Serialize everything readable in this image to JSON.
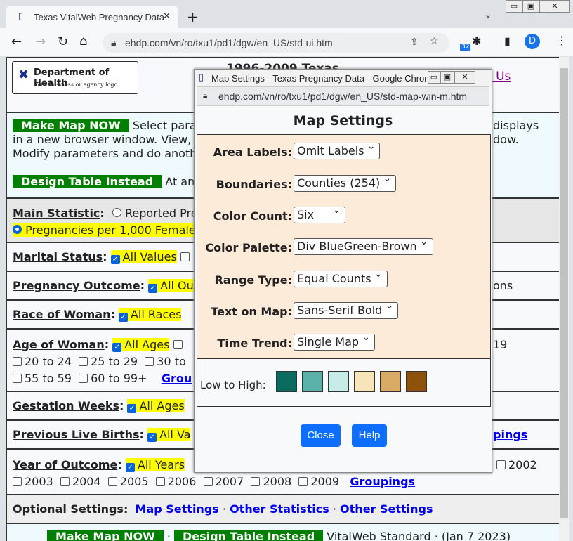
{
  "browser": {
    "tab_title": "Texas VitalWeb Pregnancy Data -",
    "url": "ehdp.com/vn/ro/txu1/pd1/dgw/en_US/std-ui.htm",
    "ext_badge": "32",
    "profile": "D"
  },
  "header": {
    "logo_title": "Department of Health",
    "logo_sub": "Your business or agency logo",
    "title_partial": "1996-2009 Texas",
    "contact_partial": "t Us"
  },
  "intro": {
    "make_map": "Make Map NOW",
    "line1": "Select para",
    "line1_right": "displays",
    "line2": "in a new browser window. View,",
    "line2_right": "dow.",
    "line3": "Modify parameters and do anoth",
    "design_table": "Design Table Instead",
    "design_text": "At an"
  },
  "main_stat": {
    "label": "Main Statistic",
    "opt1": "Reported Pre",
    "opt2": "Pregnancies per 1,000 Female"
  },
  "rows": {
    "marital": {
      "label": "Marital Status",
      "all": "All Values"
    },
    "outcome": {
      "label": "Pregnancy Outcome",
      "all": "All Ou",
      "right": "ons"
    },
    "race": {
      "label": "Race of Woman",
      "all": "All Races"
    },
    "age": {
      "label": "Age of Woman",
      "all": "All Ages",
      "right": "19",
      "opts": [
        "20 to 24",
        "25 to 29",
        "30 to",
        "55 to 59",
        "60 to 99+"
      ],
      "groupings": "Grou"
    },
    "gestation": {
      "label": "Gestation Weeks",
      "all": "All Ages"
    },
    "previous": {
      "label": "Previous Live Births",
      "all": "All Va",
      "groupings": "pings"
    },
    "year": {
      "label": "Year of Outcome",
      "all": "All Years",
      "right": "2002",
      "opts": [
        "2003",
        "2004",
        "2005",
        "2006",
        "2007",
        "2008",
        "2009"
      ],
      "groupings": "Groupings"
    },
    "optional": {
      "label": "Optional Settings",
      "links": [
        "Map Settings",
        "Other Statistics",
        "Other Settings"
      ]
    }
  },
  "footer": {
    "make_map": "Make Map NOW",
    "design_table": "Design Table Instead",
    "text": "VitalWeb Standard · (Jan 7 2023)"
  },
  "popup": {
    "window_title": "Map Settings - Texas Pregnancy Data - Google Chrome",
    "url": "ehdp.com/vn/ro/txu1/pd1/dgw/en_US/std-map-win-m.htm",
    "heading": "Map Settings",
    "settings": [
      {
        "label": "Area Labels:",
        "value": "Omit Labels"
      },
      {
        "label": "Boundaries:",
        "value": "Counties (254)"
      },
      {
        "label": "Color Count:",
        "value": "Six"
      },
      {
        "label": "Color Palette:",
        "value": "Div BlueGreen-Brown"
      },
      {
        "label": "Range Type:",
        "value": "Equal Counts"
      },
      {
        "label": "Text on Map:",
        "value": "Sans-Serif Bold"
      },
      {
        "label": "Time Trend:",
        "value": "Single Map"
      }
    ],
    "legend_label": "Low to High:",
    "palette": [
      "#0b6b5e",
      "#5bb0a7",
      "#c7ebe6",
      "#f7e4ba",
      "#d8ac66",
      "#8c510a"
    ],
    "close": "Close",
    "help": "Help"
  }
}
